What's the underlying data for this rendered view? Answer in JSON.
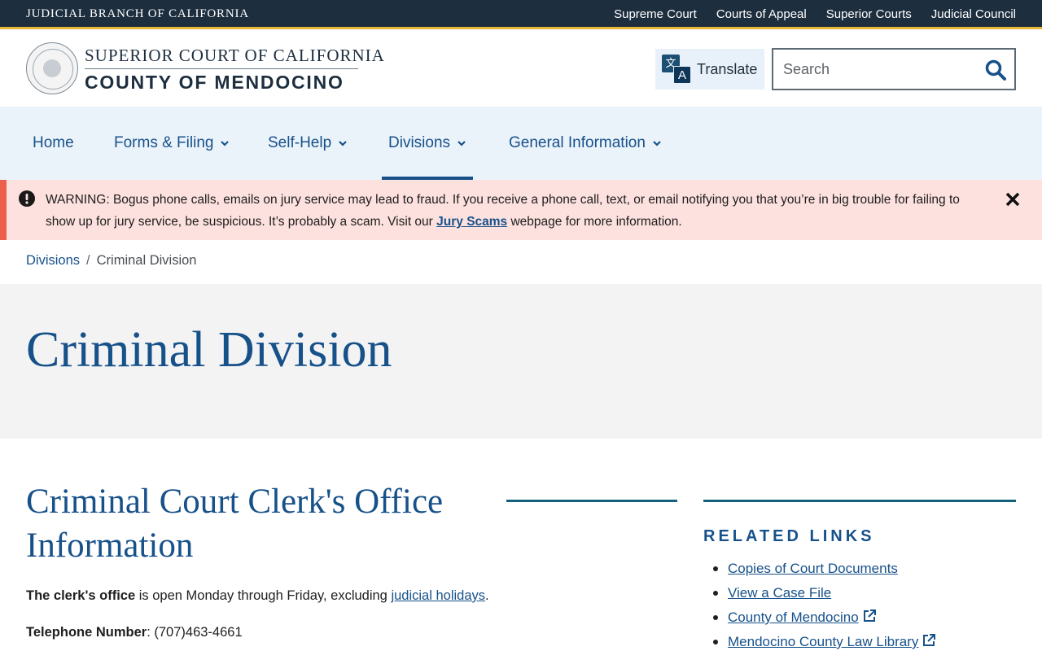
{
  "topbar": {
    "brand": "JUDICIAL BRANCH OF CALIFORNIA",
    "links": [
      "Supreme Court",
      "Courts of Appeal",
      "Superior Courts",
      "Judicial Council"
    ]
  },
  "header": {
    "line1": "SUPERIOR COURT OF CALIFORNIA",
    "line2": "COUNTY OF MENDOCINO",
    "translate_label": "Translate",
    "translate_glyph_a": "文",
    "translate_glyph_b": "A",
    "search_placeholder": "Search"
  },
  "nav": {
    "items": [
      {
        "label": "Home",
        "has_dropdown": false
      },
      {
        "label": "Forms & Filing",
        "has_dropdown": true
      },
      {
        "label": "Self-Help",
        "has_dropdown": true
      },
      {
        "label": "Divisions",
        "has_dropdown": true,
        "active": true
      },
      {
        "label": "General Information",
        "has_dropdown": true
      }
    ]
  },
  "alert": {
    "text_before": "WARNING: Bogus phone calls, emails on jury service may lead to fraud.  If you receive a phone call, text, or email notifying you that you’re in big trouble for failing to show up for jury service, be suspicious.  It’s probably a scam.  Visit our ",
    "link": "Jury Scams",
    "text_after": " webpage for more information."
  },
  "breadcrumb": {
    "parent": "Divisions",
    "separator": "/",
    "current": "Criminal Division"
  },
  "hero": {
    "title": "Criminal Division"
  },
  "main": {
    "title": "Criminal Court Clerk's Office Information",
    "p1_bold": "The clerk's office",
    "p1_text": " is open Monday through Friday, excluding ",
    "p1_link": "judicial holidays",
    "p1_end": ".",
    "p2_bold": "Telephone Number",
    "p2_text": ":  (707)463-4661"
  },
  "sidebar": {
    "title": "RELATED LINKS",
    "links": [
      {
        "label": "Copies of Court Documents",
        "external": false
      },
      {
        "label": "View a Case File",
        "external": false
      },
      {
        "label": "County of Mendocino",
        "external": true
      },
      {
        "label": "Mendocino County Law Library",
        "external": true
      }
    ]
  },
  "colors": {
    "topbar_bg": "#1d2e3f",
    "topbar_accent": "#e8b73a",
    "primary": "#17518a",
    "nav_bg": "#ebf3fa",
    "alert_bg": "#fde1de",
    "alert_accent": "#ec5f4a",
    "hero_bg": "#f3f3f3",
    "rule": "#14607a"
  },
  "icons": {
    "translate": "translate-icon",
    "search": "search-icon",
    "dropdown": "chevron-down-icon",
    "alert": "exclamation-circle-icon",
    "close": "close-icon",
    "external": "external-link-icon"
  }
}
